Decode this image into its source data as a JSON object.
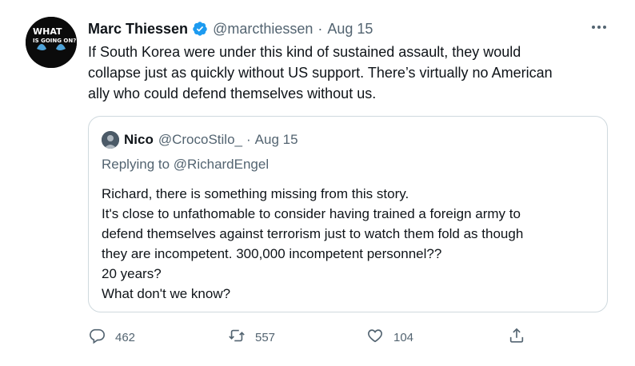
{
  "tweet": {
    "author_name": "Marc Thiessen",
    "handle": "@marcthiessen",
    "separator": "·",
    "date": "Aug 15",
    "avatar_text_line1": "WHAT",
    "avatar_text_line2": "IS GOING ON?",
    "text_lines": [
      "If South Korea were under this kind of sustained assault, they would",
      "collapse just as quickly without US support. There’s virtually no American",
      "ally who could defend themselves without us."
    ]
  },
  "quoted": {
    "author_name": "Nico",
    "handle": "@CrocoStilo_",
    "separator": "·",
    "date": "Aug 15",
    "replying_prefix": "Replying to",
    "replying_to": "@RichardEngel",
    "text_lines": [
      "Richard, there is something missing from this story.",
      "It's close to unfathomable to consider having trained a foreign army to",
      "defend themselves against terrorism just to watch them fold as though",
      "they are incompetent. 300,000 incompetent personnel??",
      "20 years?",
      "What don't we know?"
    ]
  },
  "actions": {
    "replies": "462",
    "retweets": "557",
    "likes": "104"
  },
  "colors": {
    "verified": "#1d9bf0",
    "secondary_text": "#536471",
    "border": "#cfd9de"
  },
  "icons": [
    "verified-badge-icon",
    "more-options-icon",
    "reply-icon",
    "retweet-icon",
    "like-icon",
    "share-icon"
  ]
}
